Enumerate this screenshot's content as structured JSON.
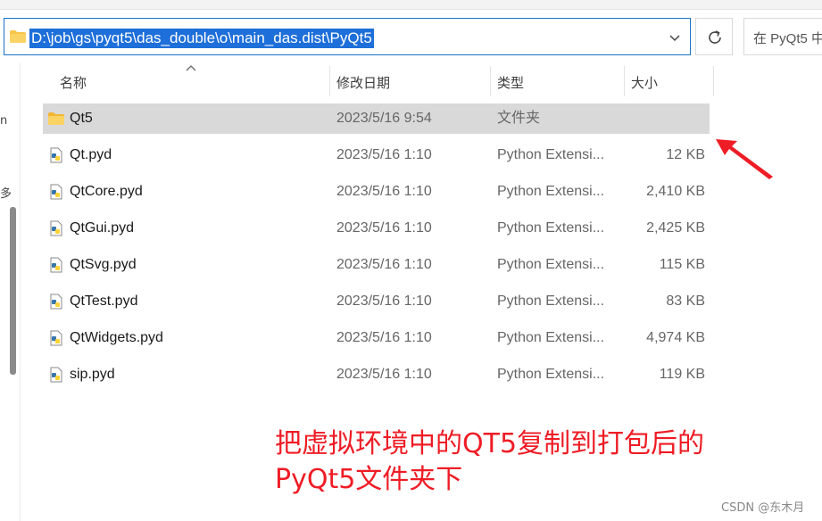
{
  "address_bar": {
    "path": "D:\\job\\gs\\pyqt5\\das_double\\o\\main_das.dist\\PyQt5"
  },
  "search": {
    "placeholder": "在 PyQt5 中"
  },
  "columns": {
    "name": "名称",
    "date": "修改日期",
    "type": "类型",
    "size": "大小"
  },
  "files": [
    {
      "name": "Qt5",
      "date": "2023/5/16 9:54",
      "type": "文件夹",
      "size": "",
      "icon": "folder-icon",
      "selected": true
    },
    {
      "name": "Qt.pyd",
      "date": "2023/5/16 1:10",
      "type": "Python Extensi...",
      "size": "12 KB",
      "icon": "python-file-icon"
    },
    {
      "name": "QtCore.pyd",
      "date": "2023/5/16 1:10",
      "type": "Python Extensi...",
      "size": "2,410 KB",
      "icon": "python-file-icon"
    },
    {
      "name": "QtGui.pyd",
      "date": "2023/5/16 1:10",
      "type": "Python Extensi...",
      "size": "2,425 KB",
      "icon": "python-file-icon"
    },
    {
      "name": "QtSvg.pyd",
      "date": "2023/5/16 1:10",
      "type": "Python Extensi...",
      "size": "115 KB",
      "icon": "python-file-icon"
    },
    {
      "name": "QtTest.pyd",
      "date": "2023/5/16 1:10",
      "type": "Python Extensi...",
      "size": "83 KB",
      "icon": "python-file-icon"
    },
    {
      "name": "QtWidgets.pyd",
      "date": "2023/5/16 1:10",
      "type": "Python Extensi...",
      "size": "4,974 KB",
      "icon": "python-file-icon"
    },
    {
      "name": "sip.pyd",
      "date": "2023/5/16 1:10",
      "type": "Python Extensi...",
      "size": "119 KB",
      "icon": "python-file-icon"
    }
  ],
  "nav_fragments": [
    "n",
    "多"
  ],
  "annotation": {
    "line1": "把虚拟环境中的QT5复制到打包后的",
    "line2": "PyQt5文件夹下",
    "color": "#ee1c25"
  },
  "watermark": "CSDN @东木月",
  "colors": {
    "accent": "#1e6fd9",
    "selected_row": "#d9d9d9",
    "folder": "#f7c548"
  }
}
